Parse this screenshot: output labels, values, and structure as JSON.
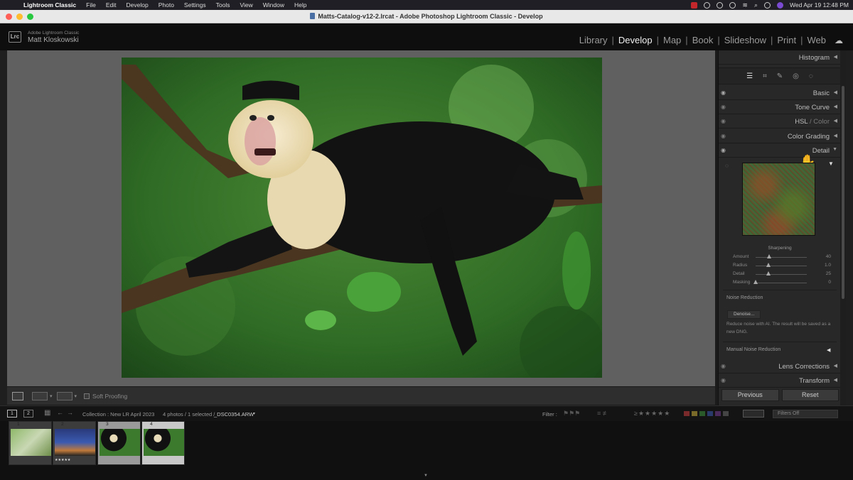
{
  "menubar": {
    "items": [
      "Lightroom Classic",
      "File",
      "Edit",
      "Develop",
      "Photo",
      "Settings",
      "Tools",
      "View",
      "Window",
      "Help"
    ],
    "datetime": "Wed Apr 19  12:48 PM"
  },
  "window": {
    "title": "Matts-Catalog-v12-2.lrcat - Adobe Photoshop Lightroom Classic - Develop"
  },
  "identity": {
    "logo": "Lrc",
    "app": "Adobe Lightroom Classic",
    "user": "Matt Kloskowski"
  },
  "modules": [
    "Library",
    "Develop",
    "Map",
    "Book",
    "Slideshow",
    "Print",
    "Web"
  ],
  "active_module": "Develop",
  "right_panel": {
    "histogram": "Histogram",
    "panels": {
      "basic": "Basic",
      "tone_curve": "Tone Curve",
      "hsl": "HSL",
      "color": "Color",
      "color_grading": "Color Grading",
      "detail": "Detail",
      "lens_corrections": "Lens Corrections",
      "transform": "Transform"
    },
    "sharpening": {
      "title": "Sharpening",
      "sliders": [
        {
          "label": "Amount",
          "value": "40",
          "level": 0.27
        },
        {
          "label": "Radius",
          "value": "1.0",
          "level": 0.25
        },
        {
          "label": "Detail",
          "value": "25",
          "level": 0.25
        },
        {
          "label": "Masking",
          "value": "0",
          "level": 0.0
        }
      ]
    },
    "noise_reduction": {
      "title": "Noise Reduction",
      "denoise_button": "Denoise...",
      "help": "Reduce noise with AI. The result will be saved as a new DNG.",
      "manual": "Manual Noise Reduction"
    },
    "previous_button": "Previous",
    "reset_button": "Reset"
  },
  "toolbar": {
    "soft_proofing": "Soft Proofing"
  },
  "filmstrip": {
    "page1": "1",
    "page2": "2",
    "source": "Collection : New LR April 2023",
    "count": "4 photos / 1 selected /",
    "filename": "_DSC0354.ARW",
    "filter_label": "Filter :",
    "filters_off": "Filters Off",
    "thumbs": [
      {
        "num": "1",
        "rating": ""
      },
      {
        "num": "2",
        "rating": "★★★★★"
      },
      {
        "num": "3",
        "rating": ""
      },
      {
        "num": "4",
        "rating": ""
      }
    ]
  },
  "colors": {
    "accent": "#f0f0f0",
    "panel_bg": "#282828",
    "center_bg": "#606060"
  }
}
